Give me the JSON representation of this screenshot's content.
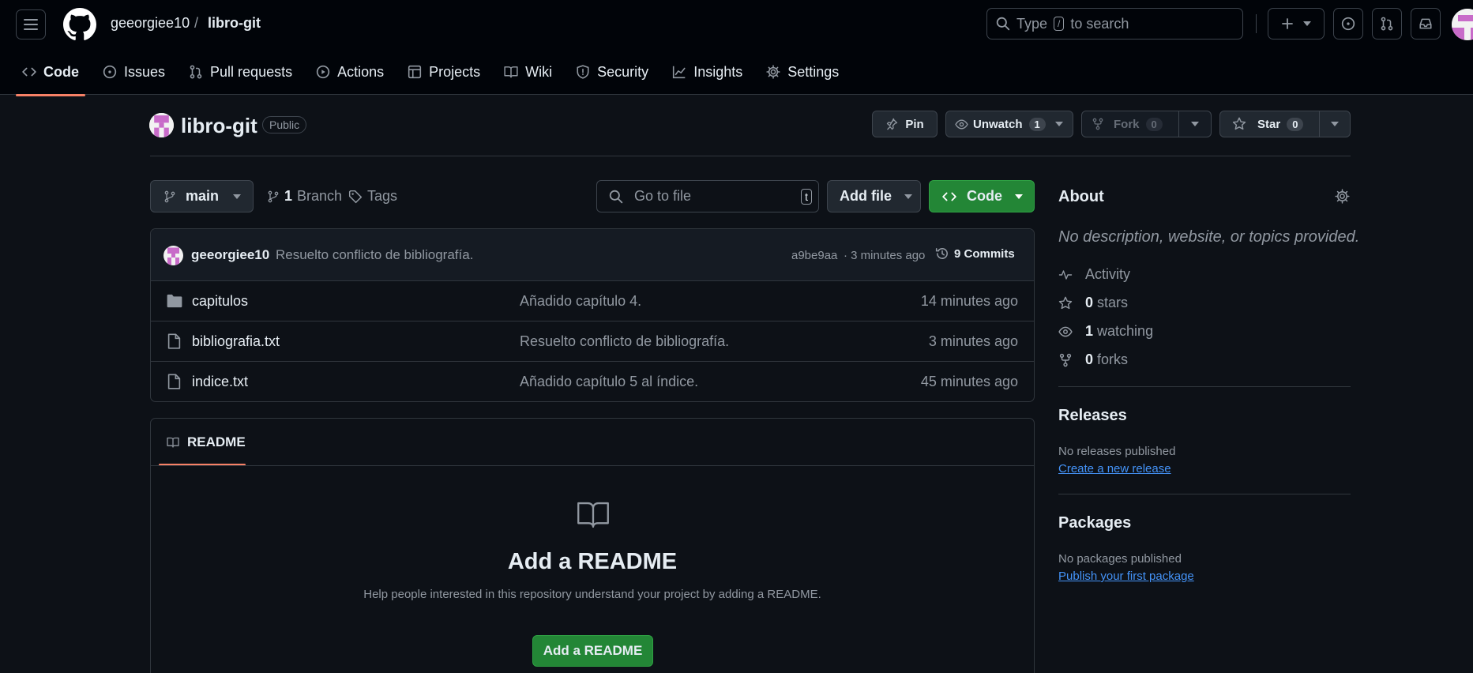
{
  "header": {
    "owner": "geeorgiee10",
    "separator": "/",
    "repo": "libro-git",
    "search": {
      "prefix": "Type",
      "key": "/",
      "suffix": "to search"
    }
  },
  "tabs": [
    {
      "label": "Code",
      "icon": "code-icon",
      "active": true
    },
    {
      "label": "Issues",
      "icon": "issue-icon"
    },
    {
      "label": "Pull requests",
      "icon": "pull-request-icon"
    },
    {
      "label": "Actions",
      "icon": "play-icon"
    },
    {
      "label": "Projects",
      "icon": "table-icon"
    },
    {
      "label": "Wiki",
      "icon": "book-icon"
    },
    {
      "label": "Security",
      "icon": "shield-icon"
    },
    {
      "label": "Insights",
      "icon": "graph-icon"
    },
    {
      "label": "Settings",
      "icon": "gear-icon"
    }
  ],
  "repo_header": {
    "name": "libro-git",
    "visibility": "Public",
    "pin_label": "Pin",
    "watch_label": "Unwatch",
    "watch_count": "1",
    "fork_label": "Fork",
    "fork_count": "0",
    "star_label": "Star",
    "star_count": "0"
  },
  "toolbar": {
    "branch": "main",
    "branch_count": "1",
    "branch_label": "Branch",
    "tags_label": "Tags",
    "go_to_file_placeholder": "Go to file",
    "go_to_file_key": "t",
    "add_file_label": "Add file",
    "code_label": "Code"
  },
  "latest_commit": {
    "author": "geeorgiee10",
    "message": "Resuelto conflicto de bibliografía.",
    "hash": "a9be9aa",
    "time": "· 3 minutes ago",
    "commits_label": "9 Commits"
  },
  "files": [
    {
      "name": "capitulos",
      "type": "folder",
      "message": "Añadido capítulo 4.",
      "time": "14 minutes ago"
    },
    {
      "name": "bibliografia.txt",
      "type": "file",
      "message": "Resuelto conflicto de bibliografía.",
      "time": "3 minutes ago"
    },
    {
      "name": "indice.txt",
      "type": "file",
      "message": "Añadido capítulo 5 al índice.",
      "time": "45 minutes ago"
    }
  ],
  "readme": {
    "tab_label": "README",
    "title": "Add a README",
    "description": "Help people interested in this repository understand your project by adding a README.",
    "button_label": "Add a README"
  },
  "about": {
    "title": "About",
    "description": "No description, website, or topics provided.",
    "activity_label": "Activity",
    "stars_count": "0",
    "stars_label": "stars",
    "watching_count": "1",
    "watching_label": "watching",
    "forks_count": "0",
    "forks_label": "forks"
  },
  "releases": {
    "title": "Releases",
    "empty_text": "No releases published",
    "link": "Create a new release"
  },
  "packages": {
    "title": "Packages",
    "empty_text": "No packages published",
    "link": "Publish your first package"
  },
  "colors": {
    "background": "#0d1117",
    "header": "#010409",
    "accent_green": "#238636",
    "link_blue": "#4493f8",
    "tab_underline": "#f78166"
  }
}
